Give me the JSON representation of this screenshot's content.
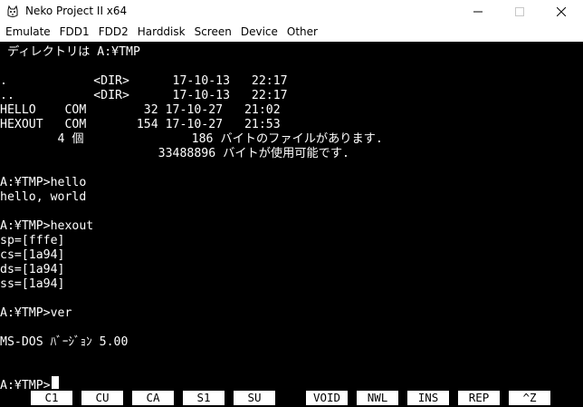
{
  "window": {
    "title": "Neko Project II x64"
  },
  "menu": {
    "items": [
      "Emulate",
      "FDD1",
      "FDD2",
      "Harddisk",
      "Screen",
      "Device",
      "Other"
    ]
  },
  "terminal": {
    "lines": [
      " ディレクトリは A:¥TMP",
      "",
      ".            <DIR>      17-10-13   22:17",
      "..           <DIR>      17-10-13   22:17",
      "HELLO    COM        32 17-10-27   21:02",
      "HEXOUT   COM       154 17-10-27   21:53",
      "        4 個               186 バイトのファイルがあります.",
      "                      33488896 バイトが使用可能です.",
      "",
      "A:¥TMP>hello",
      "hello, world",
      "",
      "A:¥TMP>hexout",
      "sp=[fffe]",
      "cs=[1a94]",
      "ds=[1a94]",
      "ss=[1a94]",
      "",
      "A:¥TMP>ver",
      "",
      "MS-DOS ﾊﾞｰｼﾞｮﾝ 5.00",
      "",
      "",
      "A:¥TMP>"
    ]
  },
  "function_keys": [
    "C1",
    "CU",
    "CA",
    "S1",
    "SU",
    "VOID",
    "NWL",
    "INS",
    "REP",
    "^Z"
  ]
}
